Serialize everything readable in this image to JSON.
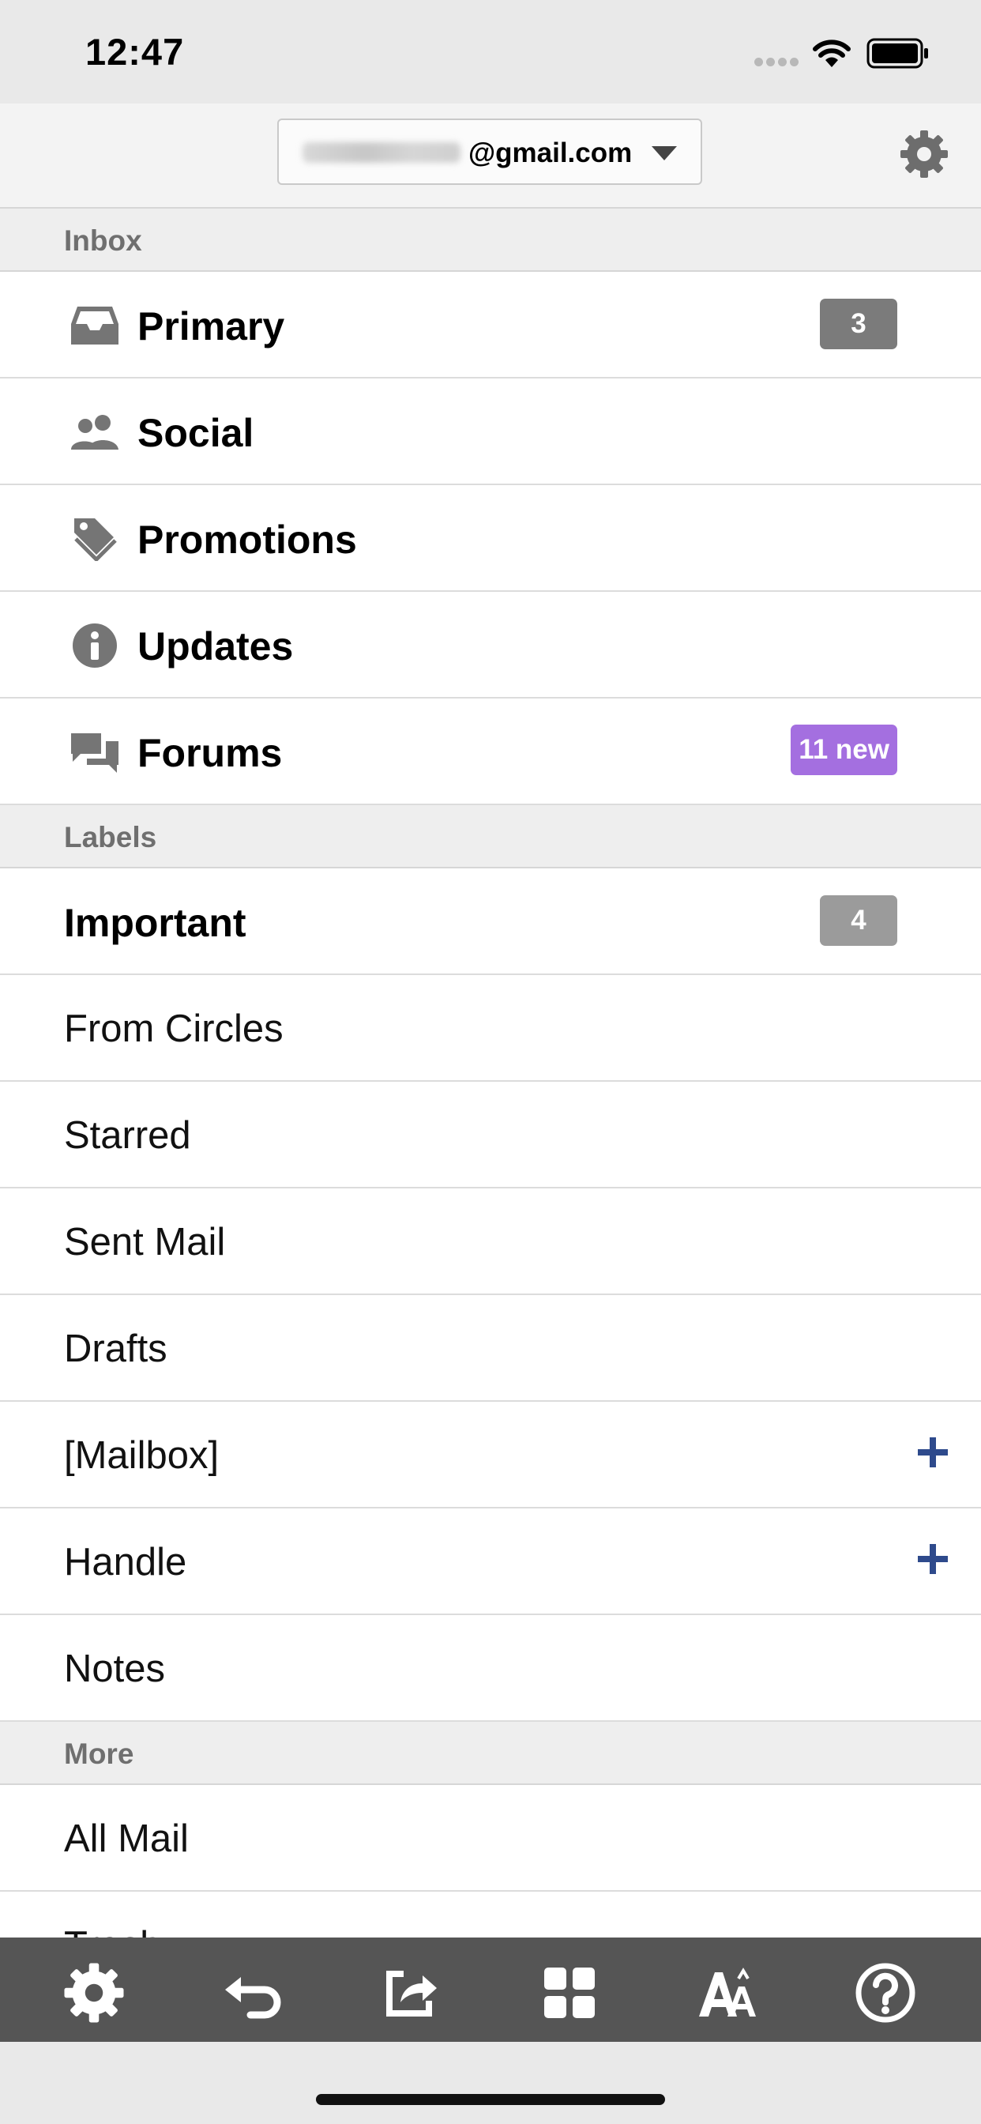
{
  "status_bar": {
    "time": "12:47"
  },
  "account": {
    "email_suffix": "@gmail.com"
  },
  "inbox": {
    "header": "Inbox",
    "items": [
      {
        "label": "Primary",
        "icon": "inbox-tray-icon",
        "count": "3"
      },
      {
        "label": "Social",
        "icon": "people-icon"
      },
      {
        "label": "Promotions",
        "icon": "tag-icon"
      },
      {
        "label": "Updates",
        "icon": "info-icon"
      },
      {
        "label": "Forums",
        "icon": "chat-bubbles-icon",
        "badge": "11 new"
      }
    ]
  },
  "labels": {
    "header": "Labels",
    "items": [
      {
        "label": "Important",
        "count": "4"
      },
      {
        "label": "From Circles"
      },
      {
        "label": "Starred"
      },
      {
        "label": "Sent Mail"
      },
      {
        "label": "Drafts"
      },
      {
        "label": "[Mailbox]",
        "expandable": true
      },
      {
        "label": "Handle",
        "expandable": true
      },
      {
        "label": "Notes"
      }
    ]
  },
  "more": {
    "header": "More",
    "items": [
      {
        "label": "All Mail"
      },
      {
        "label": "Trash"
      }
    ]
  },
  "toolbar": {
    "buttons": [
      "settings-icon",
      "back-icon",
      "share-icon",
      "grid-apps-icon",
      "text-size-icon",
      "help-icon"
    ]
  },
  "colors": {
    "forums_badge": "#a46fe0",
    "plus_icon": "#2e4a8c",
    "toolbar_bg": "#555555"
  }
}
